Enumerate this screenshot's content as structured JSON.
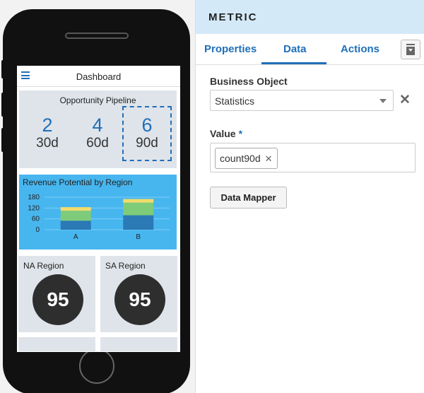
{
  "phone": {
    "app_title": "Dashboard",
    "pipeline": {
      "title": "Opportunity Pipeline",
      "metrics": [
        {
          "value": "2",
          "label": "30d"
        },
        {
          "value": "4",
          "label": "60d"
        },
        {
          "value": "6",
          "label": "90d"
        }
      ]
    },
    "revenue": {
      "title": "Revenue Potential by Region",
      "chart_data": {
        "type": "bar",
        "stacked": true,
        "categories": [
          "A",
          "B"
        ],
        "yticks": [
          "180",
          "120",
          "60",
          "0"
        ],
        "ylim": [
          0,
          180
        ],
        "series": [
          {
            "values": [
              50,
              80
            ],
            "color": "#2b79b5"
          },
          {
            "values": [
              55,
              70
            ],
            "color": "#7ecb7a"
          },
          {
            "values": [
              20,
              20
            ],
            "color": "#f2dc6a"
          }
        ]
      }
    },
    "regions": [
      {
        "title": "NA Region",
        "value": "95"
      },
      {
        "title": "SA Region",
        "value": "95"
      }
    ]
  },
  "panel": {
    "title": "METRIC",
    "tabs": [
      {
        "label": "Properties",
        "active": false
      },
      {
        "label": "Data",
        "active": true
      },
      {
        "label": "Actions",
        "active": false
      }
    ],
    "business_object": {
      "label": "Business Object",
      "value": "Statistics"
    },
    "value_field": {
      "label": "Value",
      "required_mark": "*",
      "chip": "count90d"
    },
    "data_mapper_label": "Data Mapper"
  },
  "colors": {
    "accent": "#1f6fb8",
    "header_bg": "#d4e9f8",
    "revenue_bg": "#47b6ef"
  },
  "icons": [
    "hamburger-menu-icon",
    "clear-icon",
    "remove-chip-icon",
    "chevron-down-icon",
    "panel-layout-icon"
  ]
}
